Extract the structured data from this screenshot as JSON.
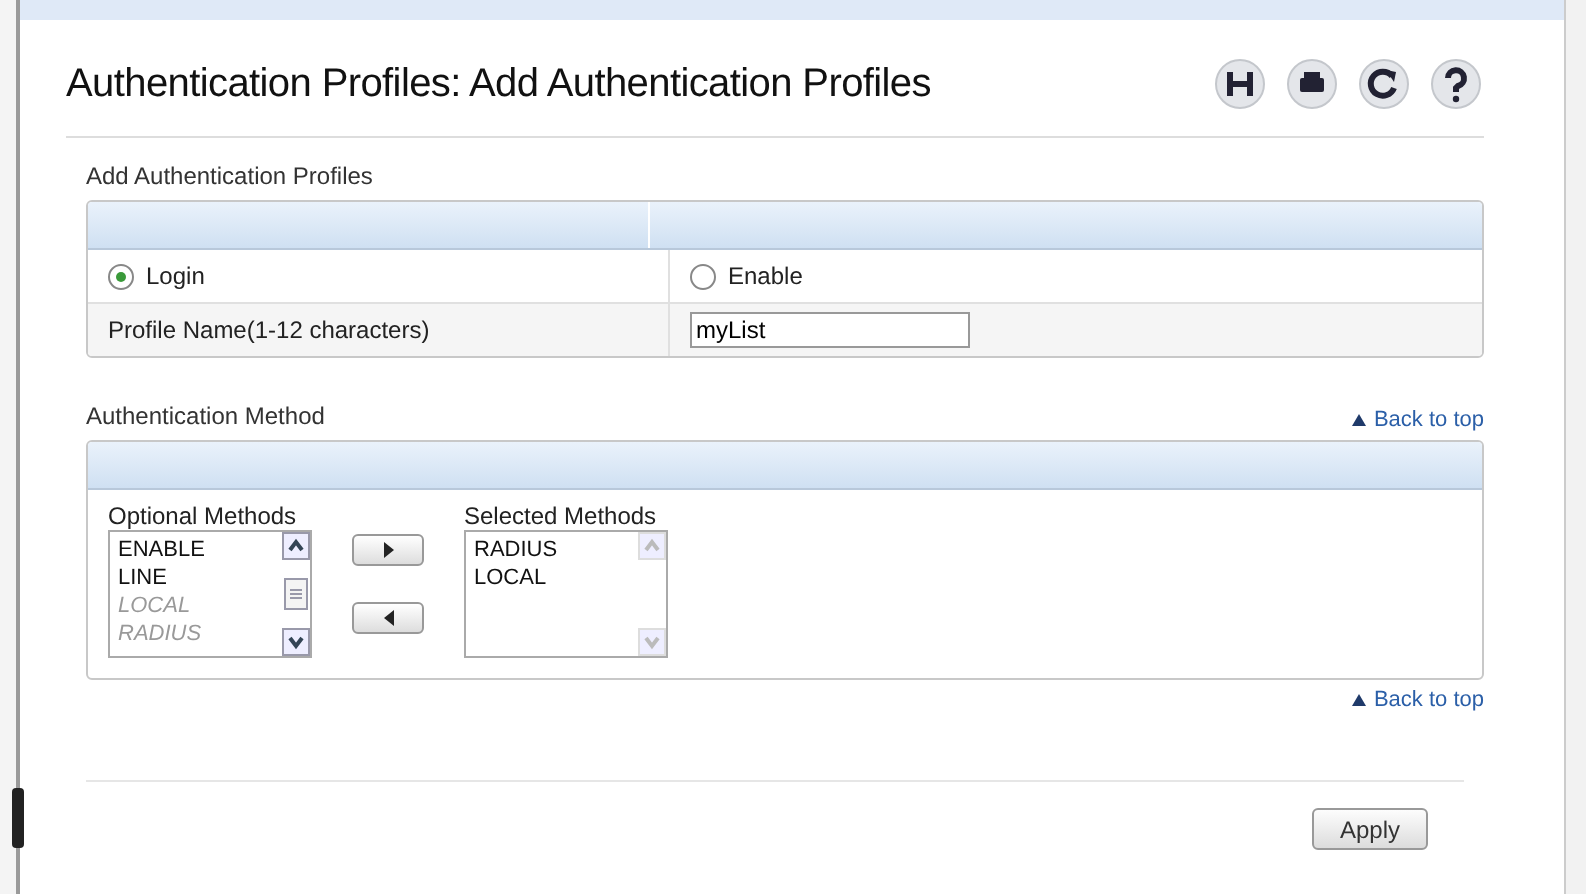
{
  "page_title": "Authentication Profiles: Add Authentication Profiles",
  "profile_section": {
    "title": "Add Authentication Profiles",
    "options": [
      {
        "label": "Login",
        "selected": true
      },
      {
        "label": "Enable",
        "selected": false
      }
    ],
    "name_label": "Profile Name(1-12 characters)",
    "name_value": "myList"
  },
  "method_section": {
    "title": "Authentication Method",
    "back_link": "Back to top",
    "optional_label": "Optional Methods",
    "optional": [
      {
        "label": "ENABLE",
        "disabled": false
      },
      {
        "label": "LINE",
        "disabled": false
      },
      {
        "label": "LOCAL",
        "disabled": true
      },
      {
        "label": "RADIUS",
        "disabled": true
      }
    ],
    "selected_label": "Selected Methods",
    "selected": [
      {
        "label": "RADIUS",
        "disabled": false
      },
      {
        "label": "LOCAL",
        "disabled": false
      }
    ],
    "bottom_link": "Back to top"
  },
  "apply_button": "Apply"
}
